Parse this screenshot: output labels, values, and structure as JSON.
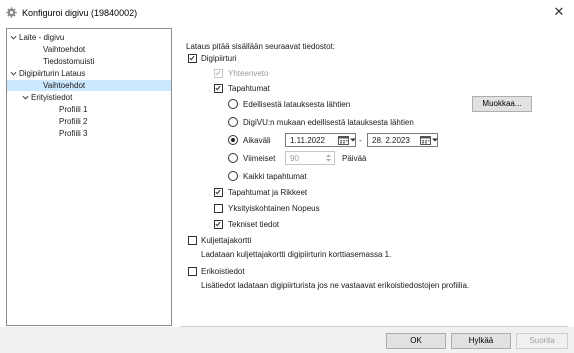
{
  "window": {
    "title": "Konfiguroi digivu (19840002)",
    "app_icon": "gear-icon",
    "close_icon": "close-icon",
    "close_glyph": "✕"
  },
  "tree": {
    "items": [
      {
        "label": "Laite - digivu",
        "expandable": true
      },
      {
        "label": "Vaihtoehdot"
      },
      {
        "label": "Tiedostomuisti"
      },
      {
        "label": "Digipiirturin Lataus",
        "expandable": true
      },
      {
        "label": "Vaihtoehdot",
        "selected": true
      },
      {
        "label": "Erityistiedot",
        "expandable": true
      },
      {
        "label": "Profiili 1"
      },
      {
        "label": "Profiili 2"
      },
      {
        "label": "Profiili 3"
      }
    ]
  },
  "content": {
    "intro": "Lataus pitää sisällään seuraavat tiedostot:",
    "digipiirturi": {
      "label": "Digipiirturi",
      "checked": true
    },
    "yhteenveto": {
      "label": "Yhteenveto",
      "checked": true,
      "disabled": true
    },
    "tapahtumat": {
      "label": "Tapahtumat",
      "checked": true
    },
    "radio_edellisesta": {
      "label": "Edellisestä latauksesta lähtien",
      "selected": false
    },
    "muokkaa_button": "Muokkaa...",
    "radio_digivu": {
      "label": "DigiVU:n mukaan edellisestä latauksesta lähtien",
      "selected": false
    },
    "radio_aikavali": {
      "label": "Aikaväli",
      "selected": true
    },
    "date_from": "1.11.2022",
    "date_separator": "-",
    "date_to": "28. 2.2023",
    "radio_viimeiset": {
      "label": "Viimeiset",
      "selected": false
    },
    "viimeiset_value": "90",
    "viimeiset_unit": "Päivää",
    "radio_kaikki": {
      "label": "Kaikki tapahtumat",
      "selected": false
    },
    "tapahtumat_rikkeet": {
      "label": "Tapahtumat ja Rikkeet",
      "checked": true
    },
    "yksityiskohtainen": {
      "label": "Yksityiskohtainen Nopeus",
      "checked": false
    },
    "tekniset": {
      "label": "Tekniset tiedot",
      "checked": true
    },
    "kuljettajakortti": {
      "label": "Kuljettajakortti",
      "checked": false
    },
    "kuljettajakortti_desc": "Ladataan kuljettajakortti digipiirturin korttiasemassa 1.",
    "erikoistiedot": {
      "label": "Erikoistiedot",
      "checked": false
    },
    "erikoistiedot_desc": "Lisätiedot ladataan digipiirturista jos ne vastaavat erikoistiedostojen profiilia."
  },
  "footer": {
    "ok": "OK",
    "hylkaa": "Hylkää",
    "suorita": "Suorita"
  },
  "colors": {
    "selection": "#cce8ff",
    "button_face": "#e1e1e1",
    "disabled_text": "#9b9b9b"
  }
}
